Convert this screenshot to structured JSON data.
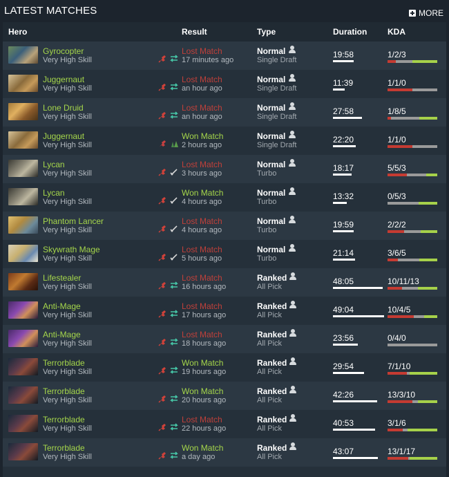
{
  "header": {
    "title": "LATEST MATCHES",
    "more_label": "MORE"
  },
  "columns": {
    "hero": "Hero",
    "result": "Result",
    "type": "Type",
    "duration": "Duration",
    "kda": "KDA"
  },
  "colors": {
    "won": "#a5d64b",
    "lost": "#c0403a",
    "kills": "#c53b32",
    "deaths": "#9a9a9a",
    "assists": "#a6d14a"
  },
  "matches": [
    {
      "hero": "Gyrocopter",
      "skill": "Very High Skill",
      "result": "Lost Match",
      "outcome": "lost",
      "time": "17 minutes ago",
      "mode": "Normal",
      "lobby": "Single Draft",
      "duration": "19:58",
      "duration_frac": 0.4,
      "kda": "1/2/3",
      "kills": 1,
      "deaths": 2,
      "assists": 3,
      "icons": "ranged"
    },
    {
      "hero": "Juggernaut",
      "skill": "Very High Skill",
      "result": "Lost Match",
      "outcome": "lost",
      "time": "an hour ago",
      "mode": "Normal",
      "lobby": "Single Draft",
      "duration": "11:39",
      "duration_frac": 0.23,
      "kda": "1/1/0",
      "kills": 1,
      "deaths": 1,
      "assists": 0,
      "icons": "ranged"
    },
    {
      "hero": "Lone Druid",
      "skill": "Very High Skill",
      "result": "Lost Match",
      "outcome": "lost",
      "time": "an hour ago",
      "mode": "Normal",
      "lobby": "Single Draft",
      "duration": "27:58",
      "duration_frac": 0.57,
      "kda": "1/8/5",
      "kills": 1,
      "deaths": 8,
      "assists": 5,
      "icons": "ranged"
    },
    {
      "hero": "Juggernaut",
      "skill": "Very High Skill",
      "result": "Won Match",
      "outcome": "won",
      "time": "2 hours ago",
      "mode": "Normal",
      "lobby": "Single Draft",
      "duration": "22:20",
      "duration_frac": 0.45,
      "kda": "1/1/0",
      "kills": 1,
      "deaths": 1,
      "assists": 0,
      "icons": "forest"
    },
    {
      "hero": "Lycan",
      "skill": "Very High Skill",
      "result": "Lost Match",
      "outcome": "lost",
      "time": "3 hours ago",
      "mode": "Normal",
      "lobby": "Turbo",
      "duration": "18:17",
      "duration_frac": 0.37,
      "kda": "5/5/3",
      "kills": 5,
      "deaths": 5,
      "assists": 3,
      "icons": "melee"
    },
    {
      "hero": "Lycan",
      "skill": "Very High Skill",
      "result": "Won Match",
      "outcome": "won",
      "time": "4 hours ago",
      "mode": "Normal",
      "lobby": "Turbo",
      "duration": "13:32",
      "duration_frac": 0.27,
      "kda": "0/5/3",
      "kills": 0,
      "deaths": 5,
      "assists": 3,
      "icons": "melee"
    },
    {
      "hero": "Phantom Lancer",
      "skill": "Very High Skill",
      "result": "Lost Match",
      "outcome": "lost",
      "time": "4 hours ago",
      "mode": "Normal",
      "lobby": "Turbo",
      "duration": "19:59",
      "duration_frac": 0.4,
      "kda": "2/2/2",
      "kills": 2,
      "deaths": 2,
      "assists": 2,
      "icons": "melee"
    },
    {
      "hero": "Skywrath Mage",
      "skill": "Very High Skill",
      "result": "Lost Match",
      "outcome": "lost",
      "time": "5 hours ago",
      "mode": "Normal",
      "lobby": "Turbo",
      "duration": "21:14",
      "duration_frac": 0.43,
      "kda": "3/6/5",
      "kills": 3,
      "deaths": 6,
      "assists": 5,
      "icons": "melee"
    },
    {
      "hero": "Lifestealer",
      "skill": "Very High Skill",
      "result": "Lost Match",
      "outcome": "lost",
      "time": "16 hours ago",
      "mode": "Ranked",
      "lobby": "All Pick",
      "duration": "48:05",
      "duration_frac": 0.97,
      "kda": "10/11/13",
      "kills": 10,
      "deaths": 11,
      "assists": 13,
      "icons": "ranged"
    },
    {
      "hero": "Anti-Mage",
      "skill": "Very High Skill",
      "result": "Lost Match",
      "outcome": "lost",
      "time": "17 hours ago",
      "mode": "Ranked",
      "lobby": "All Pick",
      "duration": "49:04",
      "duration_frac": 1.0,
      "kda": "10/4/5",
      "kills": 10,
      "deaths": 4,
      "assists": 5,
      "icons": "ranged"
    },
    {
      "hero": "Anti-Mage",
      "skill": "Very High Skill",
      "result": "Lost Match",
      "outcome": "lost",
      "time": "18 hours ago",
      "mode": "Ranked",
      "lobby": "All Pick",
      "duration": "23:56",
      "duration_frac": 0.49,
      "kda": "0/4/0",
      "kills": 0,
      "deaths": 4,
      "assists": 0,
      "icons": "ranged"
    },
    {
      "hero": "Terrorblade",
      "skill": "Very High Skill",
      "result": "Won Match",
      "outcome": "won",
      "time": "19 hours ago",
      "mode": "Ranked",
      "lobby": "All Pick",
      "duration": "29:54",
      "duration_frac": 0.61,
      "kda": "7/1/10",
      "kills": 7,
      "deaths": 1,
      "assists": 10,
      "icons": "ranged"
    },
    {
      "hero": "Terrorblade",
      "skill": "Very High Skill",
      "result": "Won Match",
      "outcome": "won",
      "time": "20 hours ago",
      "mode": "Ranked",
      "lobby": "All Pick",
      "duration": "42:26",
      "duration_frac": 0.86,
      "kda": "13/3/10",
      "kills": 13,
      "deaths": 3,
      "assists": 10,
      "icons": "ranged"
    },
    {
      "hero": "Terrorblade",
      "skill": "Very High Skill",
      "result": "Lost Match",
      "outcome": "lost",
      "time": "22 hours ago",
      "mode": "Ranked",
      "lobby": "All Pick",
      "duration": "40:53",
      "duration_frac": 0.83,
      "kda": "3/1/6",
      "kills": 3,
      "deaths": 1,
      "assists": 6,
      "icons": "ranged"
    },
    {
      "hero": "Terrorblade",
      "skill": "Very High Skill",
      "result": "Won Match",
      "outcome": "won",
      "time": "a day ago",
      "mode": "Ranked",
      "lobby": "All Pick",
      "duration": "43:07",
      "duration_frac": 0.88,
      "kda": "13/1/17",
      "kills": 13,
      "deaths": 1,
      "assists": 17,
      "icons": "ranged"
    }
  ]
}
